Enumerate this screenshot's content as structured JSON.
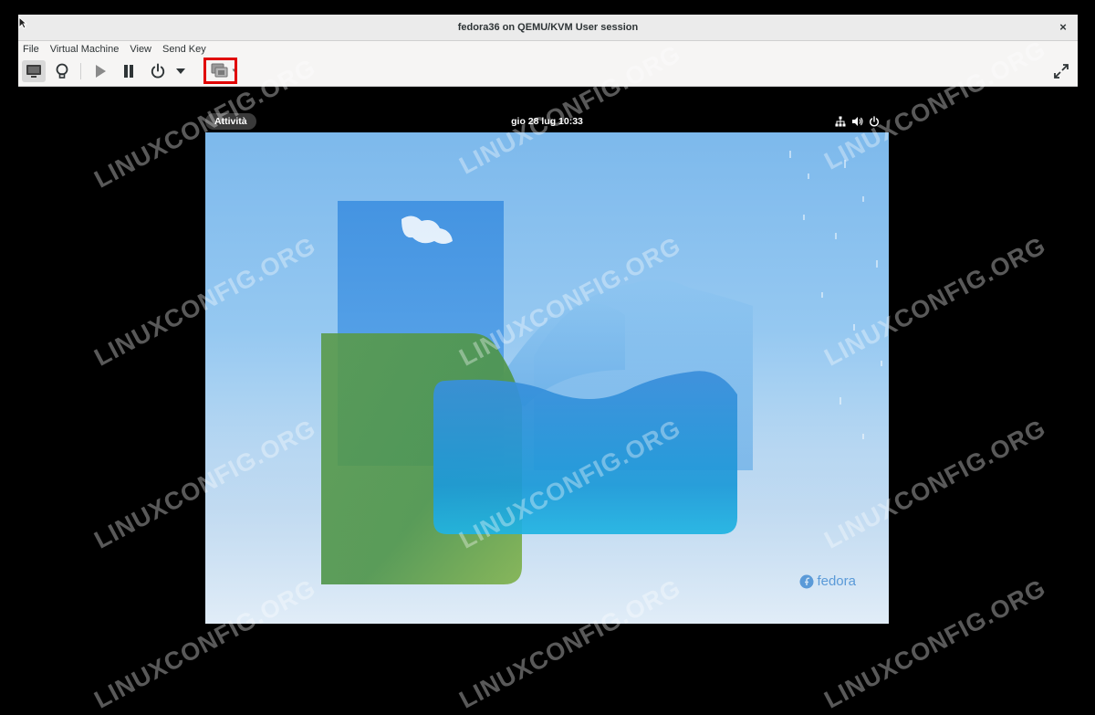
{
  "window": {
    "title": "fedora36 on QEMU/KVM User session",
    "close_glyph": "×"
  },
  "menu": {
    "items": [
      "File",
      "Virtual Machine",
      "View",
      "Send Key"
    ]
  },
  "toolbar": {
    "buttons": [
      {
        "name": "console-icon",
        "interactable": true
      },
      {
        "name": "details-lightbulb-icon",
        "interactable": true
      },
      {
        "name": "run-icon",
        "interactable": true
      },
      {
        "name": "pause-icon",
        "interactable": true
      },
      {
        "name": "power-icon",
        "interactable": true
      },
      {
        "name": "power-dropdown-icon",
        "interactable": true
      },
      {
        "name": "snapshots-icon",
        "interactable": true
      },
      {
        "name": "fullscreen-icon",
        "interactable": true
      }
    ],
    "highlight_color": "#e00000"
  },
  "guest": {
    "activities_label": "Attività",
    "clock": "gio 28 lug  10:33",
    "tray_icons": [
      "network-icon",
      "volume-icon",
      "power-icon"
    ],
    "wallpaper_logo": "fedora"
  },
  "watermark": {
    "text": "LINUXCONFIG.ORG"
  }
}
